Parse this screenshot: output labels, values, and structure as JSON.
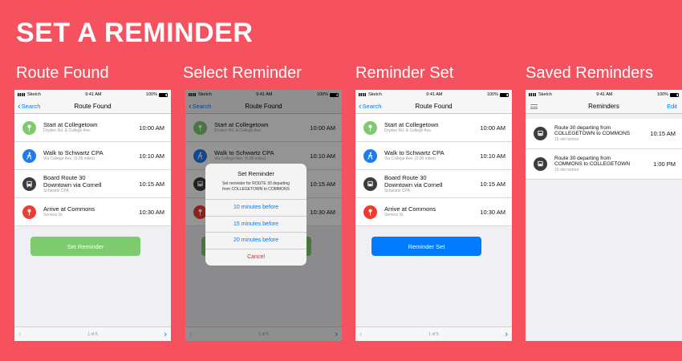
{
  "title": "SET A REMINDER",
  "colors": {
    "background": "#f5515f",
    "accent": "#007aff",
    "green_button": "#7ecb6f",
    "cancel": "#e0251b"
  },
  "status": {
    "carrier": "Sketch",
    "time": "9:41 AM",
    "battery": "100%"
  },
  "panels": [
    {
      "label": "Route Found"
    },
    {
      "label": "Select Reminder"
    },
    {
      "label": "Reminder Set"
    },
    {
      "label": "Saved Reminders"
    }
  ],
  "route_nav": {
    "back": "Search",
    "title": "Route Found"
  },
  "route": [
    {
      "icon": "pin-icon",
      "title": "Start at Collegetown",
      "sub": "Dryden Rd. & College Ave.",
      "time": "10:00 AM"
    },
    {
      "icon": "walk-icon",
      "title": "Walk to Schwartz CPA",
      "sub": "Via College Ave. (0.06 miles)",
      "time": "10:10 AM"
    },
    {
      "icon": "bus-icon",
      "title": "Board Route 30",
      "title2": "Downtown via Cornell",
      "sub": "Schwartz CPA",
      "time": "10:15 AM"
    },
    {
      "icon": "pin-icon",
      "title": "Arrive at Commons",
      "sub": "Seneca St.",
      "time": "10:30 AM"
    }
  ],
  "buttons": {
    "set_reminder": "Set Reminder",
    "reminder_set": "Reminder Set"
  },
  "pager": {
    "text": "1 of 5",
    "prev": "‹",
    "next": "›"
  },
  "dialog": {
    "title": "Set Reminder",
    "message_1": "Set reminder for ROUTE 30 departing",
    "message_2": "from COLLEGETOWN to COMMONS",
    "options": [
      "10 minutes before",
      "15 minutes before",
      "20 minutes before"
    ],
    "cancel": "Cancel"
  },
  "reminders_nav": {
    "title": "Reminders",
    "edit": "Edit"
  },
  "reminders": [
    {
      "title": "Route 30 departing from",
      "title2": "COLLEGETOWN to COMMONS",
      "sub": "15 min before",
      "time": "10:15 AM"
    },
    {
      "title": "Route 30 departing from",
      "title2": "COMMONS to COLLEGETOWN",
      "sub": "15 min before",
      "time": "1:00 PM"
    }
  ]
}
